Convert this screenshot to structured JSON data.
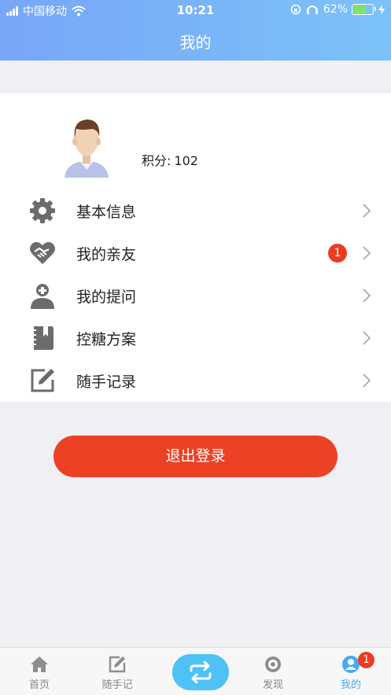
{
  "status_bar": {
    "carrier": "中国移动",
    "time": "10:21",
    "battery": "62%"
  },
  "header": {
    "title": "我的"
  },
  "profile": {
    "points_label": "积分:",
    "points_value": "102"
  },
  "menu": [
    {
      "label": "基本信息",
      "icon": "gear-icon"
    },
    {
      "label": "我的亲友",
      "icon": "handshake-heart-icon",
      "badge": "1"
    },
    {
      "label": "我的提问",
      "icon": "doctor-icon"
    },
    {
      "label": "控糖方案",
      "icon": "notebook-icon"
    },
    {
      "label": "随手记录",
      "icon": "edit-icon"
    }
  ],
  "logout_label": "退出登录",
  "tabs": [
    {
      "label": "首页",
      "icon": "home-icon"
    },
    {
      "label": "随手记",
      "icon": "note-icon"
    },
    {
      "label": "",
      "icon": "swap-icon"
    },
    {
      "label": "发现",
      "icon": "eye-icon"
    },
    {
      "label": "我的",
      "icon": "user-icon",
      "badge": "1",
      "active": true
    }
  ],
  "colors": {
    "header_start": "#78a6f7",
    "header_end": "#7cc2f8",
    "accent_red": "#ec4124",
    "tab_active": "#4ba8f2",
    "center_button": "#4fc2f5"
  }
}
